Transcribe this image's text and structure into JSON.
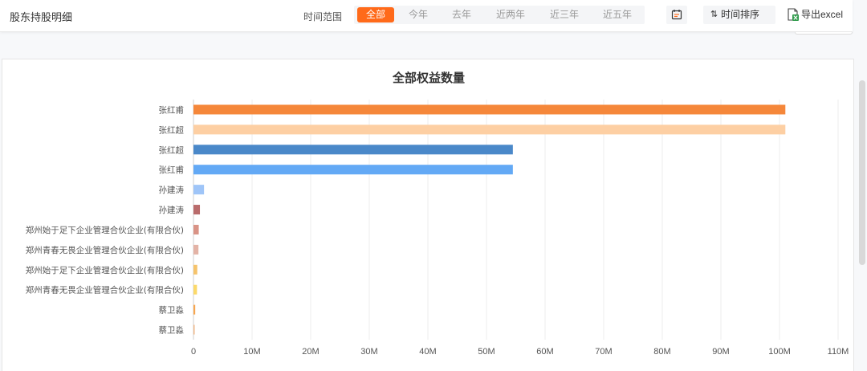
{
  "header": {
    "title": "股东持股明细",
    "range_label": "时间范围",
    "ranges": [
      "全部",
      "今年",
      "去年",
      "近两年",
      "近三年",
      "近五年"
    ],
    "active_range": "全部",
    "sort_label": "时间排序",
    "export_label": "导出excel"
  },
  "chart_data": {
    "type": "bar",
    "orientation": "horizontal",
    "title": "全部权益数量",
    "categories": [
      "张红甫",
      "张红超",
      "张红超",
      "张红甫",
      "孙建涛",
      "孙建涛",
      "郑州始于足下企业管理合伙企业(有限合伙)",
      "郑州青春无畏企业管理合伙企业(有限合伙)",
      "郑州始于足下企业管理合伙企业(有限合伙)",
      "郑州青春无畏企业管理合伙企业(有限合伙)",
      "蔡卫淼",
      "蔡卫淼"
    ],
    "values": [
      101000000,
      101000000,
      54500000,
      54500000,
      1800000,
      1100000,
      900000,
      850000,
      650000,
      600000,
      300000,
      150000
    ],
    "colors": [
      "#f5873a",
      "#fdcfa3",
      "#4a88c9",
      "#63a9f5",
      "#9fc5f8",
      "#b96b6b",
      "#d99386",
      "#e3b3a6",
      "#f5c36b",
      "#fbd96a",
      "#f7a64f",
      "#f0b88a"
    ],
    "xlim": [
      0,
      110000000
    ],
    "x_ticks": [
      0,
      10000000,
      20000000,
      30000000,
      40000000,
      50000000,
      60000000,
      70000000,
      80000000,
      90000000,
      100000000,
      110000000
    ],
    "x_tick_labels": [
      "0",
      "10M",
      "20M",
      "30M",
      "40M",
      "50M",
      "60M",
      "70M",
      "80M",
      "90M",
      "100M",
      "110M"
    ],
    "grid": true
  }
}
